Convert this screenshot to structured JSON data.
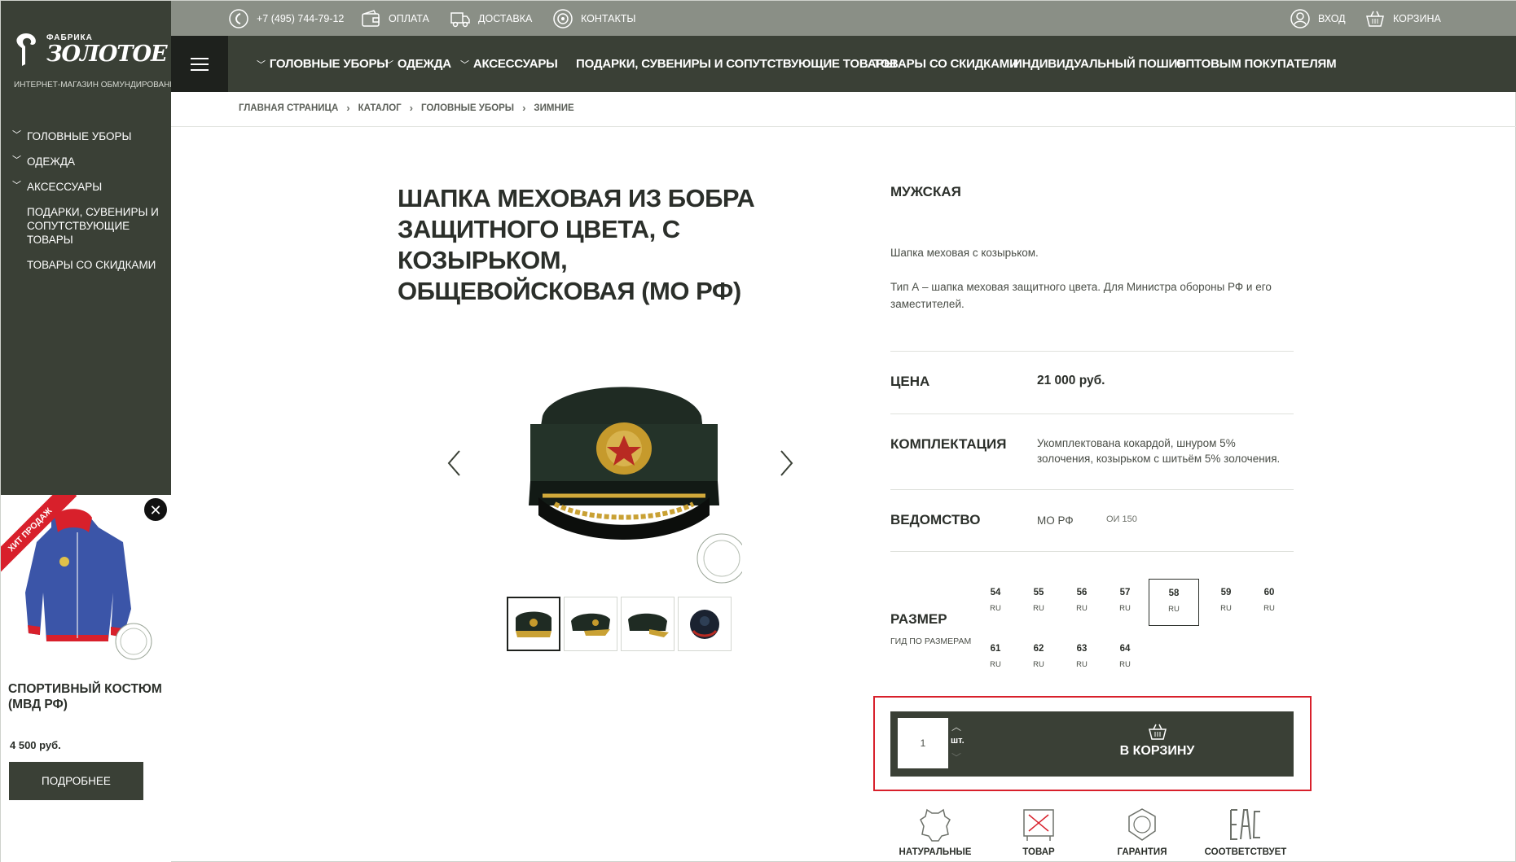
{
  "logo": {
    "factory": "ФАБРИКА",
    "name": "ЗОЛОТОЕ РУНО",
    "tagline": "ИНТЕРНЕТ-МАГАЗИН ОБМУНДИРОВАНИЯ"
  },
  "topbar": {
    "phone": "+7 (495) 744-79-12",
    "payment": "ОПЛАТА",
    "delivery": "ДОСТАВКА",
    "contacts": "КОНТАКТЫ",
    "login": "ВХОД",
    "cart": "КОРЗИНА"
  },
  "nav": {
    "items": [
      "ГОЛОВНЫЕ УБОРЫ",
      "ОДЕЖДА",
      "АКСЕССУАРЫ",
      "ПОДАРКИ, СУВЕНИРЫ И СОПУТСТВУЮЩИЕ ТОВАРЫ",
      "ТОВАРЫ СО СКИДКАМИ",
      "ИНДИВИДУАЛЬНЫЙ ПОШИВ",
      "ОПТОВЫМ ПОКУПАТЕЛЯМ"
    ]
  },
  "sidebar": {
    "items": [
      "ГОЛОВНЫЕ УБОРЫ",
      "ОДЕЖДА",
      "АКСЕССУАРЫ",
      "ПОДАРКИ, СУВЕНИРЫ И СОПУТСТВУЮЩИЕ ТОВАРЫ",
      "ТОВАРЫ СО СКИДКАМИ"
    ]
  },
  "breadcrumb": [
    "ГЛАВНАЯ СТРАНИЦА",
    "КАТАЛОГ",
    "ГОЛОВНЫЕ УБОРЫ",
    "ЗИМНИЕ"
  ],
  "product": {
    "title": "ШАПКА МЕХОВАЯ ИЗ БОБРА ЗАЩИТНОГО ЦВЕТА, С КОЗЫРЬКОМ, ОБЩЕВОЙСКОВАЯ (МО РФ)",
    "subtitle": "МУЖСКАЯ",
    "description": [
      "Шапка меховая с козырьком.",
      "Тип А – шапка меховая защитного цвета. Для Министра обороны РФ и его заместителей."
    ],
    "price_label": "ЦЕНА",
    "price": "21 000 руб.",
    "kit_label": "КОМПЛЕКТАЦИЯ",
    "kit": "Укомплектована кокардой, шнуром 5% золочения, козырьком с шитьём 5% золочения.",
    "dept_label": "ВЕДОМСТВО",
    "dept": "МО РФ",
    "dept_code": "ОИ 150",
    "size_label": "РАЗМЕР",
    "size_guide": "ГИД ПО РАЗМЕРАМ",
    "sizes": [
      {
        "num": "54",
        "unit": "RU"
      },
      {
        "num": "55",
        "unit": "RU"
      },
      {
        "num": "56",
        "unit": "RU"
      },
      {
        "num": "57",
        "unit": "RU"
      },
      {
        "num": "58",
        "unit": "RU"
      },
      {
        "num": "59",
        "unit": "RU"
      },
      {
        "num": "60",
        "unit": "RU"
      },
      {
        "num": "61",
        "unit": "RU"
      },
      {
        "num": "62",
        "unit": "RU"
      },
      {
        "num": "63",
        "unit": "RU"
      },
      {
        "num": "64",
        "unit": "RU"
      }
    ],
    "selected_size": "58",
    "qty": "1",
    "qty_unit": "шт.",
    "add_to_cart": "В КОРЗИНУ"
  },
  "features": [
    "НАТУРАЛЬНЫЕ",
    "ТОВАР",
    "ГАРАНТИЯ",
    "СООТВЕТСТВУЕТ"
  ],
  "promo": {
    "badge": "ХИТ ПРОДАЖ",
    "title": "СПОРТИВНЫЙ КОСТЮМ (МВД РФ)",
    "price": "4 500 руб.",
    "button": "ПОДРОБНЕЕ"
  },
  "colors": {
    "dark_green": "#3a4036",
    "top_gray": "#8a8f86",
    "highlight_red": "#d8202b"
  }
}
